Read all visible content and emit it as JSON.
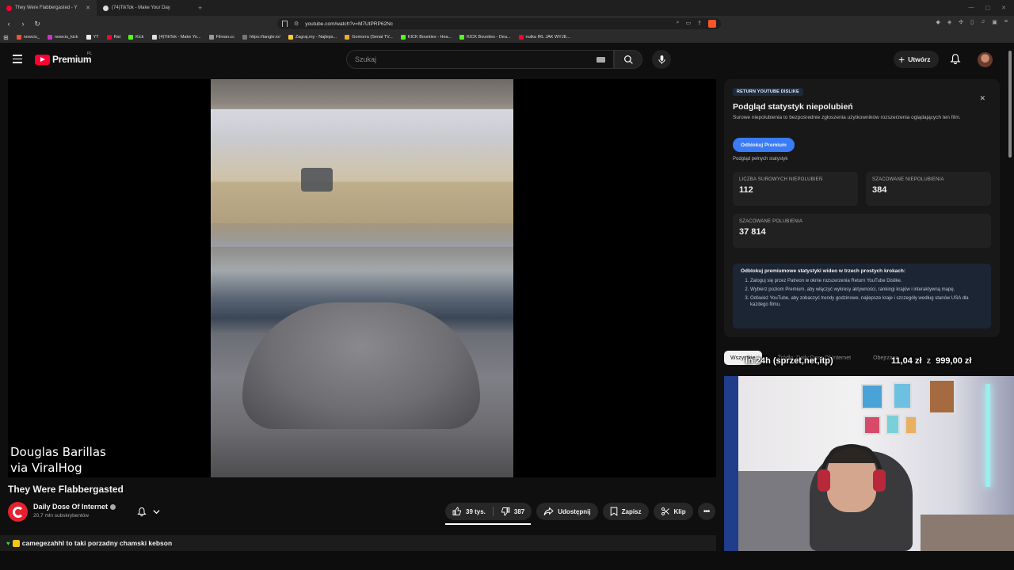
{
  "browser": {
    "tabs": [
      {
        "title": "They Were Flabbergasted - Y",
        "active": true
      },
      {
        "title": "(74)TikTok - Make Your Day",
        "active": false
      }
    ],
    "url": "youtube.com/watch?v=M7UtPRP62Nc",
    "bookmarks": [
      "nowciu_",
      "nowciu_kick",
      "YT",
      "Rat",
      "Kick",
      "(4)TikTok - Make Yo...",
      "Filman.cc",
      "https://tangle.io/",
      "Zagraj.my - Najleps...",
      "Gomorra (Serial TV...",
      "KICK Bounties - Hea...",
      "KICK Bounties - Dea...",
      "nutka IRL JAK WYJE..."
    ]
  },
  "youtube": {
    "logo_text": "Premium",
    "logo_region": "PL",
    "search_placeholder": "Szukaj",
    "create_label": "Utwórz"
  },
  "video": {
    "watermark_line1": "Douglas Barillas",
    "watermark_line2": "via ViralHog",
    "title": "They Were Flabbergasted",
    "channel": "Daily Dose Of Internet",
    "subscribers": "20,7 mln subskrybentów",
    "likes": "39 tys.",
    "dislikes": "387",
    "share_label": "Udostępnij",
    "save_label": "Zapisz",
    "clip_label": "Klip",
    "like_ratio": 0.99
  },
  "chat": {
    "message": "camegezahhl to taki porzadny chamski kebson"
  },
  "ryd": {
    "tag": "RETURN YOUTUBE DISLIKE",
    "heading": "Podgląd statystyk niepolubień",
    "description": "Surowe niepolubienia to bezpośrednie zgłoszenia użytkowników rozszerzenia oglądających ten film.",
    "unlock_button": "Odblokuj Premium",
    "preview_label": "Podgląd pełnych statystyk",
    "stats": [
      {
        "label": "LICZBA SUROWYCH NIEPOLUBIEŃ",
        "value": "112"
      },
      {
        "label": "SZACOWANE NIEPOLUBIENIA",
        "value": "384"
      },
      {
        "label": "SZACOWANE POLUBIENIA",
        "value": "37 814"
      }
    ],
    "steps_title": "Odblokuj premiumowe statystyki wideo w trzech prostych krokach:",
    "steps": [
      "Zaloguj się przez Patreon w oknie rozszerzenia Return YouTube Dislike.",
      "Wybierz poziom Premium, aby włączyć wykresy aktywności, rankingi krajów i interaktywną mapę.",
      "Odśwież YouTube, aby zobaczyć trendy godzinowe, najlepsze kraje i szczegóły według stanów USA dla każdego filmu."
    ]
  },
  "chips": [
    "Wszystkie",
    "Źródło: Daily Dose Of Internet",
    "Obejrzane"
  ],
  "stream_overlay": {
    "left": "In 24h (sprzet,net,itp)",
    "current": "11,04 zł",
    "separator": "z",
    "goal": "999,00 zł"
  }
}
